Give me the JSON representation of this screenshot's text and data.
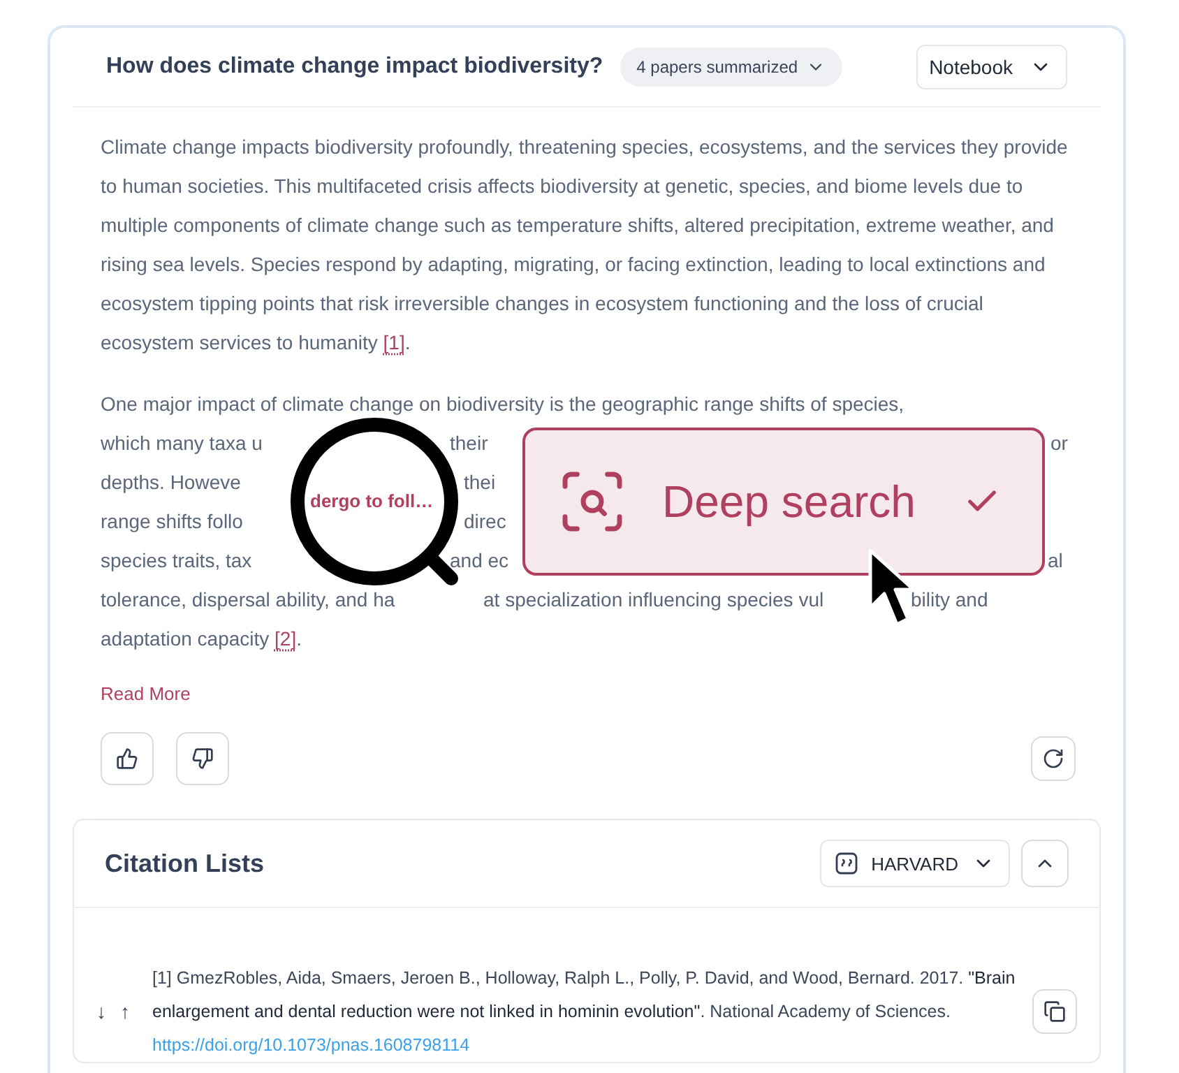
{
  "header": {
    "question": "How does climate change impact biodiversity?",
    "papers_chip": "4 papers summarized",
    "notebook_select": "Notebook"
  },
  "paragraph_1": {
    "text": "Climate change impacts biodiversity profoundly, threatening species, ecosystems, and the services they provide to human societies. This multifaceted crisis affects biodiversity at genetic, species, and biome levels due to multiple components of climate change such as temperature shifts, altered precipitation, extreme weather, and rising sea levels. Species respond by adapting, migrating, or facing extinction, leading to local extinctions and ecosystem tipping points that risk irreversible changes in ecosystem functioning and the loss of crucial ecosystem services to humanity",
    "citation": "[1]",
    "after": "."
  },
  "paragraph_2": {
    "lines": [
      [
        "One major impact of climate change on biodiversity is the geographic range shifts of species,"
      ],
      [
        "which many taxa u",
        "their",
        "or"
      ],
      [
        "depths. Howeve",
        "thei"
      ],
      [
        "range shifts follo",
        "direc"
      ],
      [
        "species traits, tax",
        "and ec",
        "al"
      ],
      [
        "tolerance, dispersal ability, and ha",
        "at specialization influencing species vul",
        "bility and"
      ]
    ],
    "tail": "adaptation capacity",
    "citation": "[2]",
    "after": "."
  },
  "magnifier": {
    "text": "dergo to foll…"
  },
  "deep_search": {
    "label": "Deep search",
    "checked": true
  },
  "read_more": "Read More",
  "citations": {
    "title": "Citation Lists",
    "style": "HARVARD",
    "expanded": true,
    "items": [
      {
        "sort_down": "↓",
        "sort_up": "↑",
        "text": "[1] GmezRobles, Aida, Smaers, Jeroen B., Holloway, Ralph L., Polly, P. David, and Wood, Bernard. 2017. **\"Brain enlargement and dental reduction were not linked in hominin evolution\"**. National Academy of Sciences.",
        "link": "https://doi.org/10.1073/pnas.1608798114"
      }
    ]
  }
}
